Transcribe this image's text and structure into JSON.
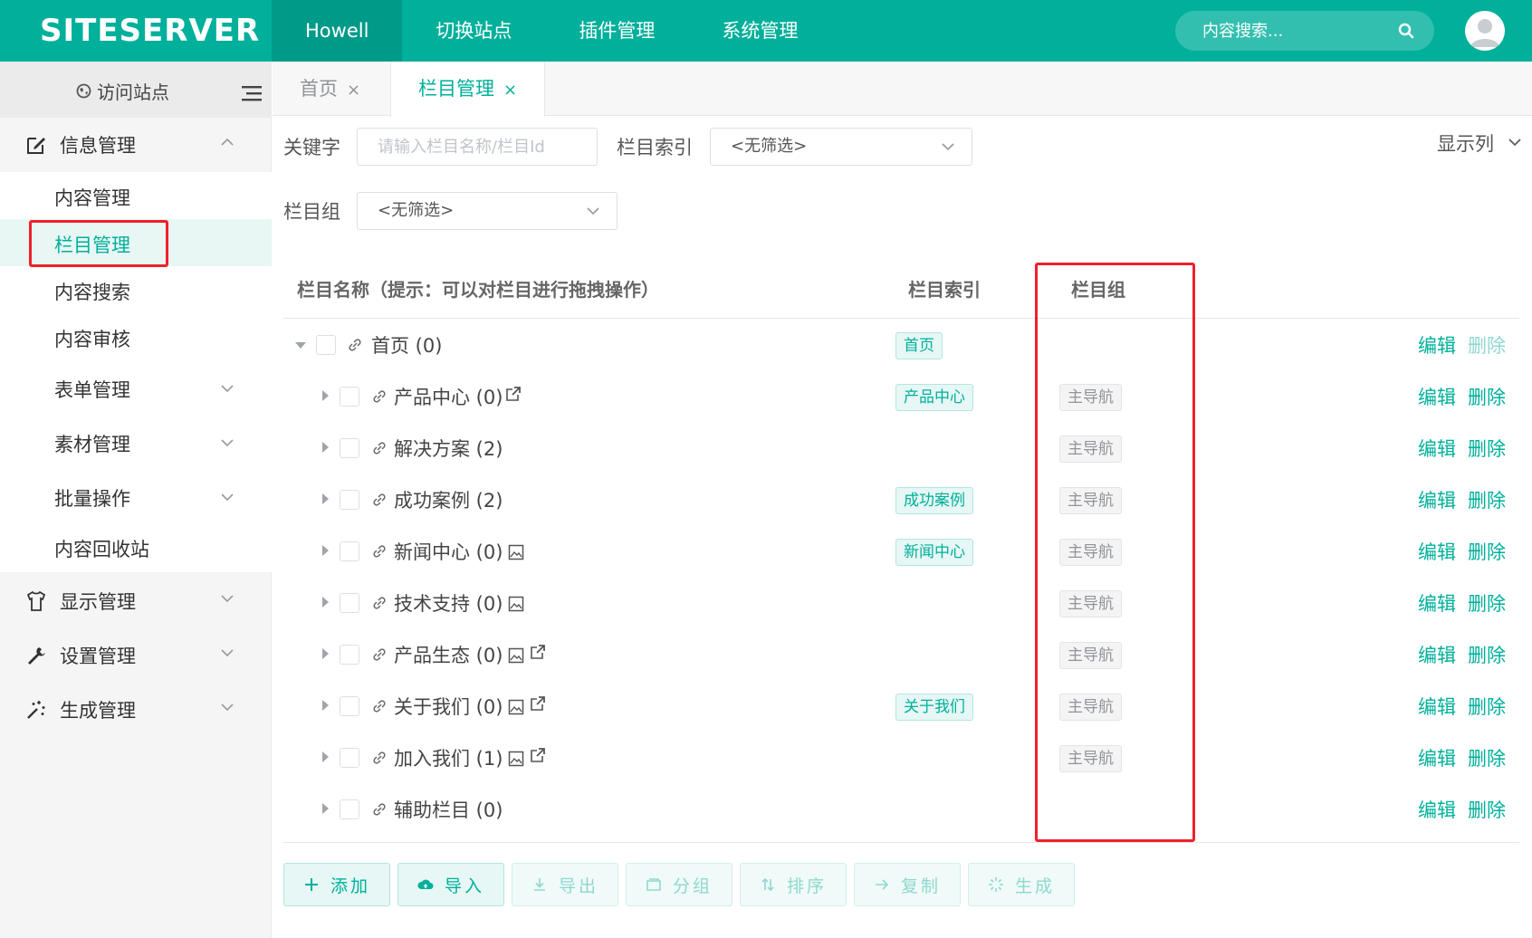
{
  "header": {
    "logo_text": "SITESERVER",
    "nav": [
      "Howell",
      "切换站点",
      "插件管理",
      "系统管理"
    ],
    "search_placeholder": "内容搜索..."
  },
  "sidebar": {
    "visit_label": "访问站点",
    "groups": {
      "info": "信息管理",
      "display": "显示管理",
      "settings": "设置管理",
      "generate": "生成管理"
    },
    "info_items": [
      "内容管理",
      "栏目管理",
      "内容搜索",
      "内容审核",
      "表单管理",
      "素材管理",
      "批量操作",
      "内容回收站"
    ]
  },
  "tabs": [
    {
      "label": "首页",
      "close": "×"
    },
    {
      "label": "栏目管理",
      "close": "×"
    }
  ],
  "filters": {
    "keyword_label": "关键字",
    "keyword_placeholder": "请输入栏目名称/栏目Id",
    "index_label": "栏目索引",
    "index_value": "<无筛选>",
    "group_label": "栏目组",
    "group_value": "<无筛选>",
    "show_columns": "显示列"
  },
  "table": {
    "headers": {
      "name": "栏目名称（提示：可以对栏目进行拖拽操作）",
      "index": "栏目索引",
      "group": "栏目组"
    },
    "edit_label": "编辑",
    "delete_label": "删除",
    "rows": [
      {
        "name": "首页 (0)",
        "index": "首页",
        "group": ""
      },
      {
        "name": "产品中心 (0)",
        "index": "产品中心",
        "group": "主导航"
      },
      {
        "name": "解决方案 (2)",
        "index": "",
        "group": "主导航"
      },
      {
        "name": "成功案例 (2)",
        "index": "成功案例",
        "group": "主导航"
      },
      {
        "name": "新闻中心 (0)",
        "index": "新闻中心",
        "group": "主导航"
      },
      {
        "name": "技术支持 (0)",
        "index": "",
        "group": "主导航"
      },
      {
        "name": "产品生态 (0)",
        "index": "",
        "group": "主导航"
      },
      {
        "name": "关于我们 (0)",
        "index": "关于我们",
        "group": "主导航"
      },
      {
        "name": "加入我们 (1)",
        "index": "",
        "group": "主导航"
      },
      {
        "name": "辅助栏目 (0)",
        "index": "",
        "group": ""
      }
    ]
  },
  "buttons": [
    "添加",
    "导入",
    "导出",
    "分组",
    "排序",
    "复制",
    "生成"
  ],
  "colors": {
    "brand": "#00b09b",
    "highlight_box": "#f0202a"
  }
}
